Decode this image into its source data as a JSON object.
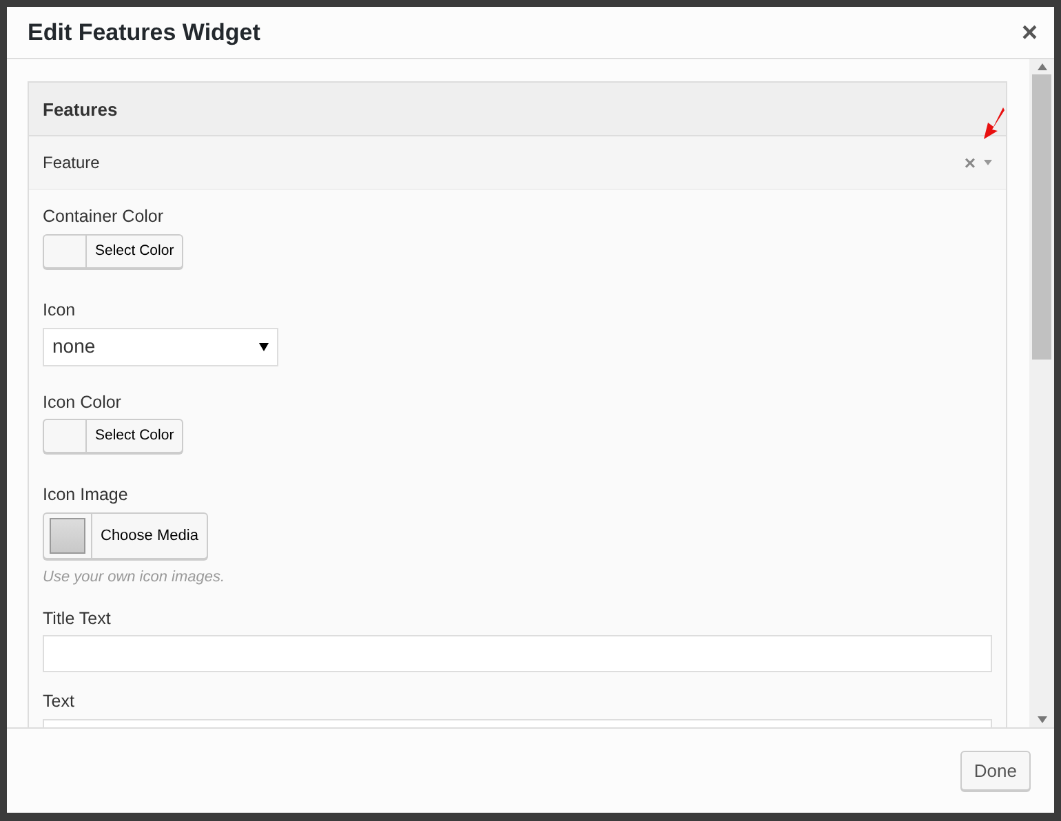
{
  "dialog": {
    "title": "Edit Features Widget",
    "close": "×"
  },
  "section": {
    "title": "Features"
  },
  "item": {
    "title": "Feature",
    "remove": "×",
    "expanded": true
  },
  "fields": [
    {
      "kind": "color",
      "label": "Container Color",
      "button": "Select Color"
    },
    {
      "kind": "select",
      "label": "Icon",
      "value": "none"
    },
    {
      "kind": "color",
      "label": "Icon Color",
      "button": "Select Color"
    },
    {
      "kind": "media",
      "label": "Icon Image",
      "button": "Choose Media",
      "help": "Use your own icon images."
    },
    {
      "kind": "text",
      "label": "Title Text"
    },
    {
      "kind": "text",
      "label": "Text"
    }
  ],
  "footer": {
    "button": "Done"
  }
}
